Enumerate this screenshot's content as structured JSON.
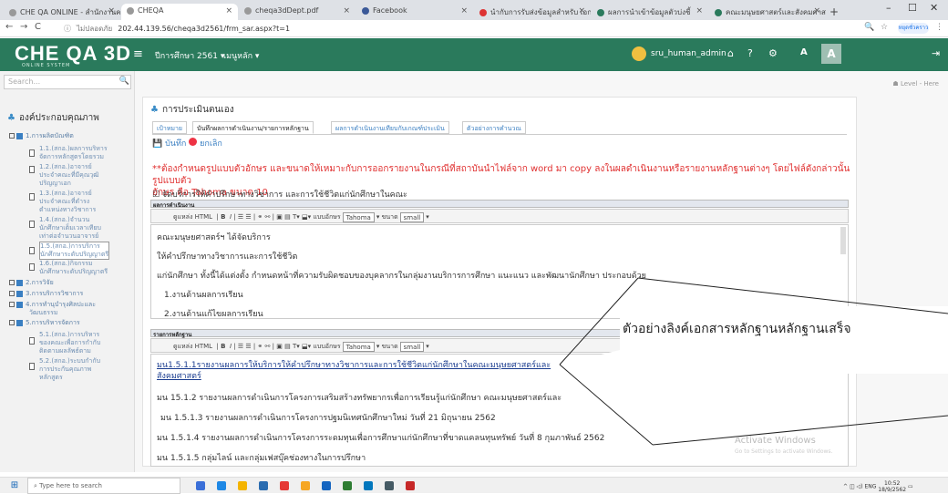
{
  "browser": {
    "tabs": [
      {
        "label": "CHE QA ONLINE - สำนักงานคณะ",
        "active": false
      },
      {
        "label": "CHEQA",
        "active": true
      },
      {
        "label": "cheqa3dDept.pdf",
        "active": false
      },
      {
        "label": "Facebook",
        "active": false
      },
      {
        "label": "นำกับการรับส่งข้อมูลสำหรับ เอกสาร",
        "active": false
      },
      {
        "label": "ผลการนำเข้าข้อมูลตัวบ่งชี้",
        "active": false
      },
      {
        "label": "คณะมนุษยศาสตร์และสังคมศาสตร์",
        "active": false
      }
    ],
    "url_info": "ไม่ปลอดภัย",
    "url": "202.44.139.56/cheqa3d2561/frm_sar.aspx?t=1",
    "profile_label": "หยุดชั่วคราว"
  },
  "app": {
    "logo": "CHE QA 3D",
    "logo_sub": "ONLINE SYSTEM",
    "nav_year": "ปีการศึกษา 2561 ▾",
    "nav_menu": "เมนูหลัก ▾",
    "user_name": "sru_human_admin",
    "font_small": "A",
    "font_big": "A"
  },
  "sidebar": {
    "search_placeholder": "Search...",
    "heading": "องค์ประกอบคุณภาพ",
    "items": [
      {
        "label": "1.การผลิตบัณฑิต"
      },
      {
        "label": "2.การวิจัย"
      },
      {
        "label": "3.การบริการวิชาการ"
      },
      {
        "label": "4.การทำนุบำรุงศิลปะและ",
        "label2": "วัฒนธรรม"
      },
      {
        "label": "5.การบริหารจัดการ"
      }
    ],
    "subitems_1": [
      {
        "line1": "1.1.(สกอ.)ผลการบริหาร",
        "line2": "จัดการหลักสูตรโดยรวม"
      },
      {
        "line1": "1.2.(สกอ.)อาจารย์",
        "line2": "ประจำคณะที่มีคุณวุฒิ",
        "line3": "ปริญญาเอก"
      },
      {
        "line1": "1.3.(สกอ.)อาจารย์",
        "line2": "ประจำคณะที่ดำรง",
        "line3": "ตำแหน่งทางวิชาการ"
      },
      {
        "line1": "1.4.(สกอ.)จำนวน",
        "line2": "นักศึกษาเต็มเวลาเทียบ",
        "line3": "เท่าต่อจำนวนอาจารย์"
      },
      {
        "line1": "1.5.(สกอ.)การบริการ",
        "line2": "นักศึกษาระดับปริญญาตรี"
      },
      {
        "line1": "1.6.(สกอ.)กิจกรรม",
        "line2": "นักศึกษาระดับปริญญาตรี"
      }
    ],
    "subitems_5": [
      {
        "line1": "5.1.(สกอ.)การบริหาร",
        "line2": "ของคณะเพื่อการกำกับ",
        "line3": "ติดตามผลลัพธ์ตาม"
      },
      {
        "line1": "5.2.(สกอ.)ระบบกำกับ",
        "line2": "การประกันคุณภาพ",
        "line3": "หลักสูตร"
      }
    ]
  },
  "main": {
    "level": "Level - Here",
    "title": "การประเมินตนเอง",
    "tabs": [
      "เป้าหมาย",
      "บันทึกผลการดำเนินงาน/รายการหลักฐาน",
      "ผลการดำเนินงานเทียบกับเกณฑ์ประเมิน",
      "ตัวอย่างการคำนวณ"
    ],
    "save_label": "บันทึก",
    "cancel_label": "ยกเลิก",
    "warning_line1": "**ต้องกำหนดรูปแบบตัวอักษร และขนาดให้เหมาะกับการออกรายงานในกรณีที่สถาบันนำไฟล์จาก word มา copy ลงในผลดำเนินงานหรือรายงานหลักฐานต่างๆ โดยไฟล์ดังกล่าวนั้น รูปแบบตัว",
    "warning_line2": "อักษร คือ Tahoma ขนาด 10",
    "check_line": "☑ จัดบริการให้คำปรึกษาทางวิชาการ และการใช้ชีวิตแก่นักศึกษาในคณะ",
    "editor1": {
      "label": "ผลการดำเนินงาน",
      "html_btn": "ดูแหล่ง HTML",
      "font_label": "แบบอักษร",
      "font_value": "Tahoma",
      "size_label": "ขนาด",
      "size_value": "small",
      "lines": [
        "คณะมนุษยศาสตร์ฯ ได้จัดบริการ",
        "ให้คำปรึกษาทางวิชาการและการใช้ชีวิต",
        "แก่นักศึกษา ทั้งนี้ได้แต่งตั้ง กำหนดหน้าที่ความรับผิดชอบของบุคลากรในกลุ่มงานบริการการศึกษา แนะแนว และพัฒนานักศึกษา ประกอบด้วย",
        "1.งานด้านผลการเรียน",
        "2.งานด้านแก้ไขผลการเรียน"
      ]
    },
    "editor2": {
      "label": "รายการหลักฐาน",
      "html_btn": "ดูแหล่ง HTML",
      "font_label": "แบบอักษร",
      "font_value": "Tahoma",
      "size_label": "ขนาด",
      "size_value": "small",
      "lines": [
        "มน1.5.1.1รายงานผลการให้บริการให้คำปรึกษาทางวิชาการและการใช้ชีวิตแก่นักศึกษาในคณะมนุษยศาสตร์และ",
        "สังคมศาสตร์",
        "มน 15.1.2 รายงานผลการดำเนินการโครงการเสริมสร้างทรัพยากรเพื่อการเรียนรู้แก่นักศึกษา คณะมนุษยศาสตร์และ",
        "มน 1.5.1.3 รายงานผลการดำเนินการโครงการปฐมนิเทศนักศึกษาใหม่ วันที่ 21 มิถุนายน 2562",
        "มน 1.5.1.4 รายงานผลการดำเนินการโครงการระดมทุนเพื่อการศึกษาแก่นักศึกษาที่ขาดแคลนทุนทรัพย์ วันที่ 8 กุมภาพันธ์ 2562",
        "มน 1.5.1.5 กลุ่มไลน์ และกลุ่มเฟสบุ๊คช่องทางในการปรึกษา"
      ]
    }
  },
  "annotation": {
    "text": "ตัวอย่างลิงค์เอกสารหลักฐานหลักฐานเสร็จ"
  },
  "overlay": {
    "watermark": "Activate Windows",
    "watermark_sub": "Go to Settings to activate Windows."
  },
  "taskbar": {
    "search_placeholder": "Type here to search",
    "time": "10:52",
    "date": "18/9/2562",
    "lang": "ENG"
  }
}
